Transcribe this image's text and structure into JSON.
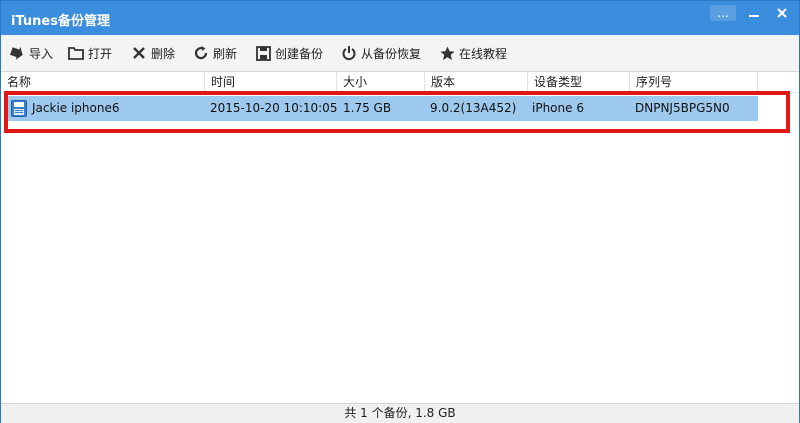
{
  "window": {
    "title": "iTunes备份管理",
    "help_label": "...",
    "accent": "#3b8ede"
  },
  "toolbar": {
    "import_label": "导入",
    "open_label": "打开",
    "delete_label": "删除",
    "refresh_label": "刷新",
    "create_label": "创建备份",
    "restore_label": "从备份恢复",
    "tutorial_label": "在线教程"
  },
  "table": {
    "columns": [
      "名称",
      "时间",
      "大小",
      "版本",
      "设备类型",
      "序列号"
    ],
    "rows": [
      {
        "name": "Jackie iphone6",
        "time": "2015-10-20 10:10:05",
        "size": "1.75 GB",
        "version": "9.0.2(13A452)",
        "device": "iPhone 6",
        "serial": "DNPNJ5BPG5N0"
      }
    ]
  },
  "status": {
    "summary": "共 1 个备份, 1.8 GB"
  },
  "colors": {
    "selection": "#9ec9ef",
    "highlight_border": "#e01818"
  }
}
